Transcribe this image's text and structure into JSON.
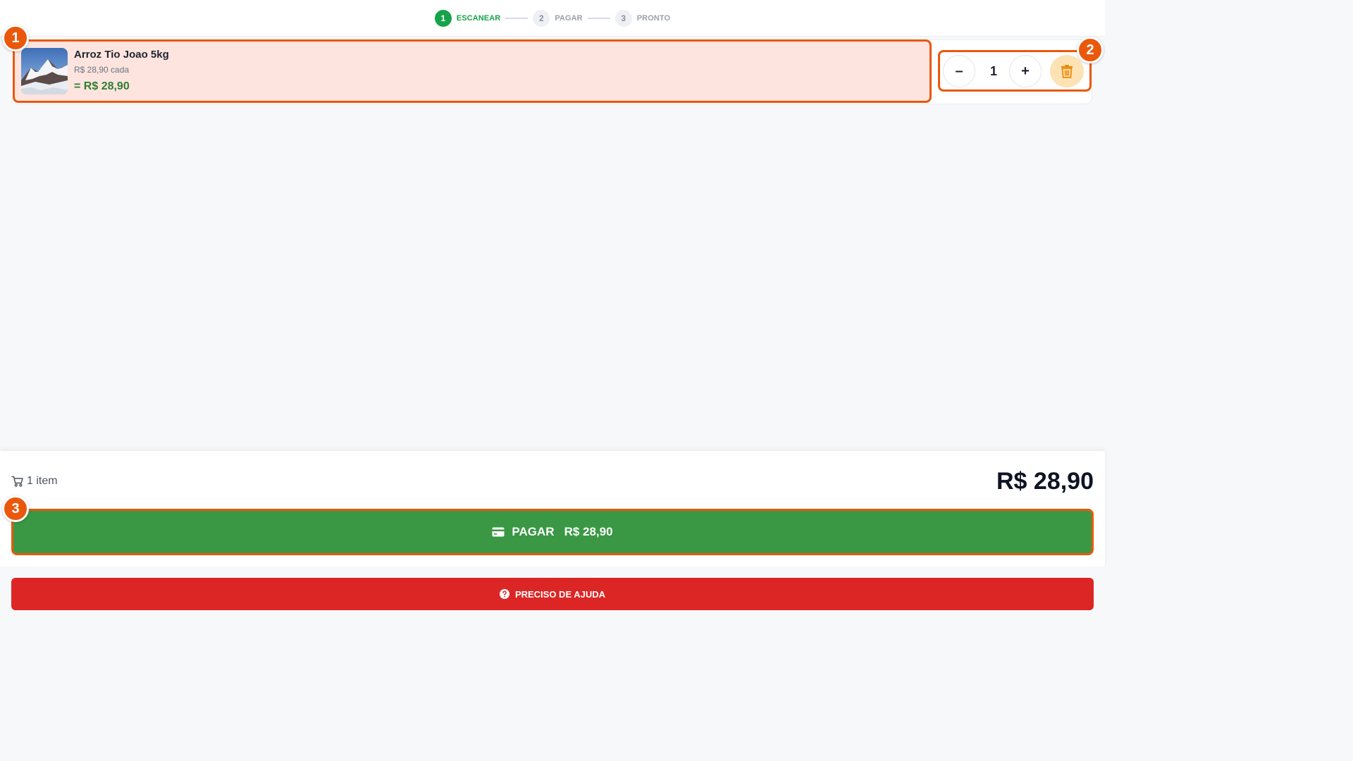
{
  "stepper": {
    "steps": [
      {
        "num": "1",
        "label": "ESCANEAR",
        "active": true
      },
      {
        "num": "2",
        "label": "PAGAR",
        "active": false
      },
      {
        "num": "3",
        "label": "PRONTO",
        "active": false
      }
    ]
  },
  "cart_items": [
    {
      "name": "Arroz Tio Joao 5kg",
      "unit_price": "R$ 28,90 cada",
      "subtotal": "= R$ 28,90",
      "quantity": "1",
      "minus_label": "–",
      "plus_label": "+",
      "thumbnail_icon": "mountain-photo",
      "delete_icon": "trash-icon"
    }
  ],
  "callouts": [
    "1",
    "2",
    "3"
  ],
  "summary": {
    "item_count": "1 item",
    "total": "R$ 28,90",
    "cart_icon": "cart-icon"
  },
  "pay_button": {
    "label": "PAGAR",
    "amount": "R$ 28,90",
    "icon": "credit-card-icon"
  },
  "help_button": {
    "label": "PRECISO DE AJUDA",
    "icon": "question-circle-icon"
  },
  "colors": {
    "accent_green": "#16a34a",
    "pay_green": "#3a9844",
    "highlight_orange": "#ea580c",
    "help_red": "#dc2626",
    "item_bg": "#fde4de"
  }
}
